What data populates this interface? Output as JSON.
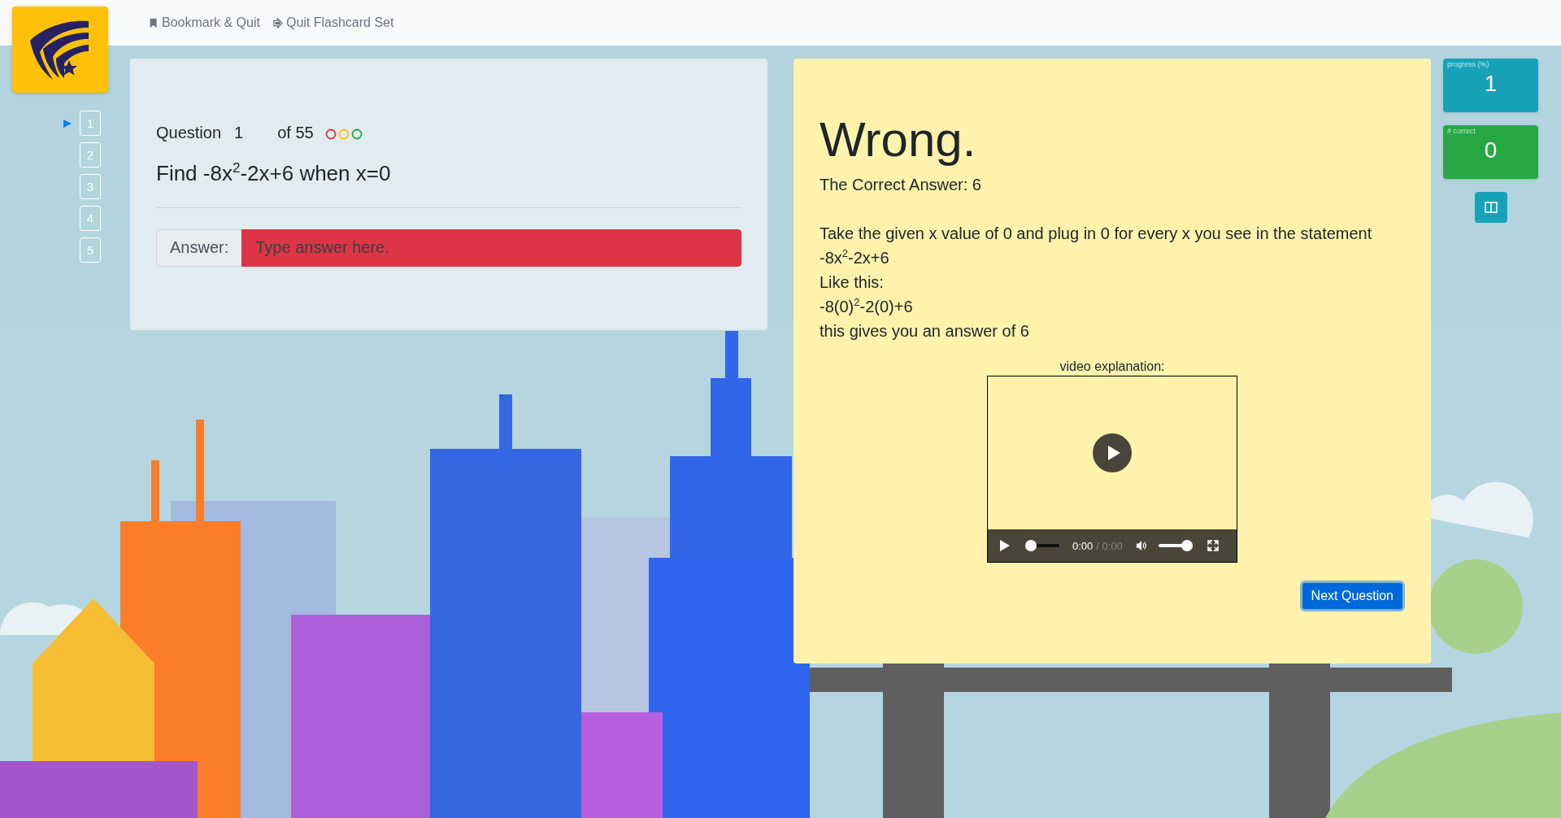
{
  "nav": {
    "links": [
      {
        "label": "Bookmark & Quit",
        "kind": "bookmark"
      },
      {
        "label": "Quit Flashcard Set",
        "kind": "exit"
      }
    ]
  },
  "question_nav": [
    {
      "label": "1",
      "selected": true
    },
    {
      "label": "2",
      "selected": false
    },
    {
      "label": "3",
      "selected": false
    },
    {
      "label": "4",
      "selected": false
    },
    {
      "label": "5",
      "selected": false
    }
  ],
  "question": {
    "label": "Question",
    "number": "1",
    "of": "of 55",
    "status_dots": [
      {
        "color": "#dc3545"
      },
      {
        "color": "#ffc107"
      },
      {
        "color": "#28a745"
      }
    ],
    "prompt": "Find -8x$^{2}$-2x+6 when x=0",
    "answer": {
      "label": "Answer:",
      "placeholder": "Type answer here.",
      "invalid": true
    }
  },
  "feedback": {
    "verdict": "Wrong.",
    "correct_answer": "The Correct Answer: 6",
    "explanation": [
      "Take the given x value of 0 and plug in 0 for every x you see in the statement",
      "-8x$^{2}$-2x+6",
      "Like this:",
      "-8(0)$^{2}$-2(0)+6",
      "this gives you an answer of 6"
    ],
    "video": {
      "caption": "video explanation:",
      "current_time": "0:00",
      "duration": "/ 0:00",
      "progress": {
        "level": 0
      },
      "volume": {
        "level": 1
      }
    },
    "button": "Next Question"
  },
  "stats": [
    {
      "label": "progress (%)",
      "value": "1",
      "color": "#17a2b8"
    },
    {
      "label": "# correct",
      "value": "0",
      "color": "#28a745"
    }
  ]
}
